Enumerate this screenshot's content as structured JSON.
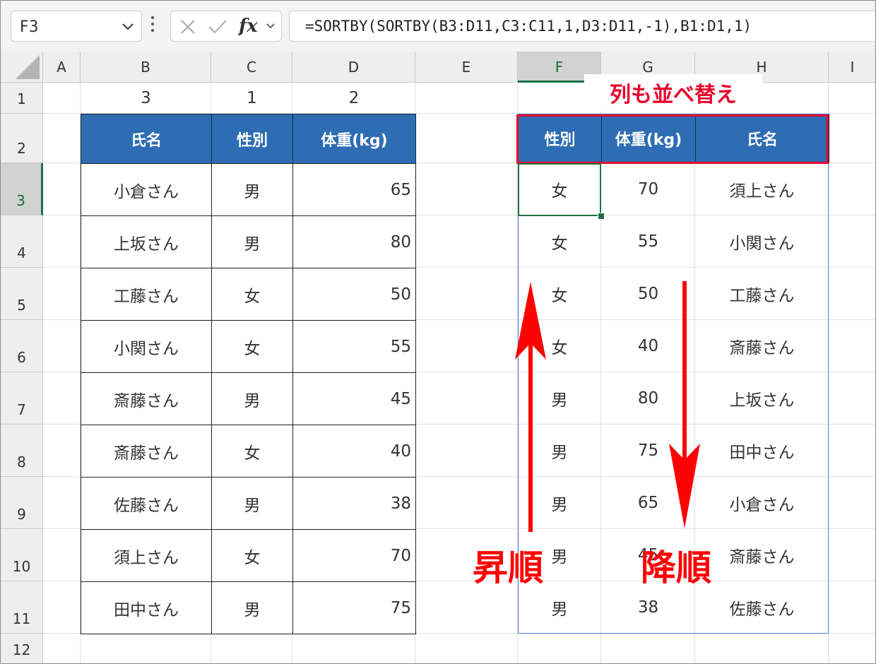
{
  "formula_bar": {
    "name_box": "F3",
    "fx_label": "fx",
    "formula": "=SORTBY(SORTBY(B3:D11,C3:C11,1,D3:D11,-1),B1:D1,1)"
  },
  "columns": [
    "A",
    "B",
    "C",
    "D",
    "E",
    "F",
    "G",
    "H",
    "I"
  ],
  "rows": [
    "1",
    "2",
    "3",
    "4",
    "5",
    "6",
    "7",
    "8",
    "9",
    "10",
    "11",
    "12"
  ],
  "source": {
    "order_row": [
      "3",
      "1",
      "2"
    ],
    "headers": [
      "氏名",
      "性別",
      "体重(kg)"
    ],
    "records": [
      [
        "小倉さん",
        "男",
        "65"
      ],
      [
        "上坂さん",
        "男",
        "80"
      ],
      [
        "工藤さん",
        "女",
        "50"
      ],
      [
        "小関さん",
        "女",
        "55"
      ],
      [
        "斎藤さん",
        "男",
        "45"
      ],
      [
        "斎藤さん",
        "女",
        "40"
      ],
      [
        "佐藤さん",
        "男",
        "38"
      ],
      [
        "須上さん",
        "女",
        "70"
      ],
      [
        "田中さん",
        "男",
        "75"
      ]
    ]
  },
  "result": {
    "headers": [
      "性別",
      "体重(kg)",
      "氏名"
    ],
    "records": [
      [
        "女",
        "70",
        "須上さん"
      ],
      [
        "女",
        "55",
        "小関さん"
      ],
      [
        "女",
        "50",
        "工藤さん"
      ],
      [
        "女",
        "40",
        "斎藤さん"
      ],
      [
        "男",
        "80",
        "上坂さん"
      ],
      [
        "男",
        "75",
        "田中さん"
      ],
      [
        "男",
        "65",
        "小倉さん"
      ],
      [
        "男",
        "45",
        "斎藤さん"
      ],
      [
        "男",
        "38",
        "佐藤さん"
      ]
    ]
  },
  "annotations": {
    "column_sort": "列も並べ替え",
    "ascending": "昇順",
    "descending": "降順"
  },
  "colors": {
    "header_fill": "#2e6db4",
    "annotation_red": "#ff0000",
    "selection_green": "#1e7145"
  }
}
